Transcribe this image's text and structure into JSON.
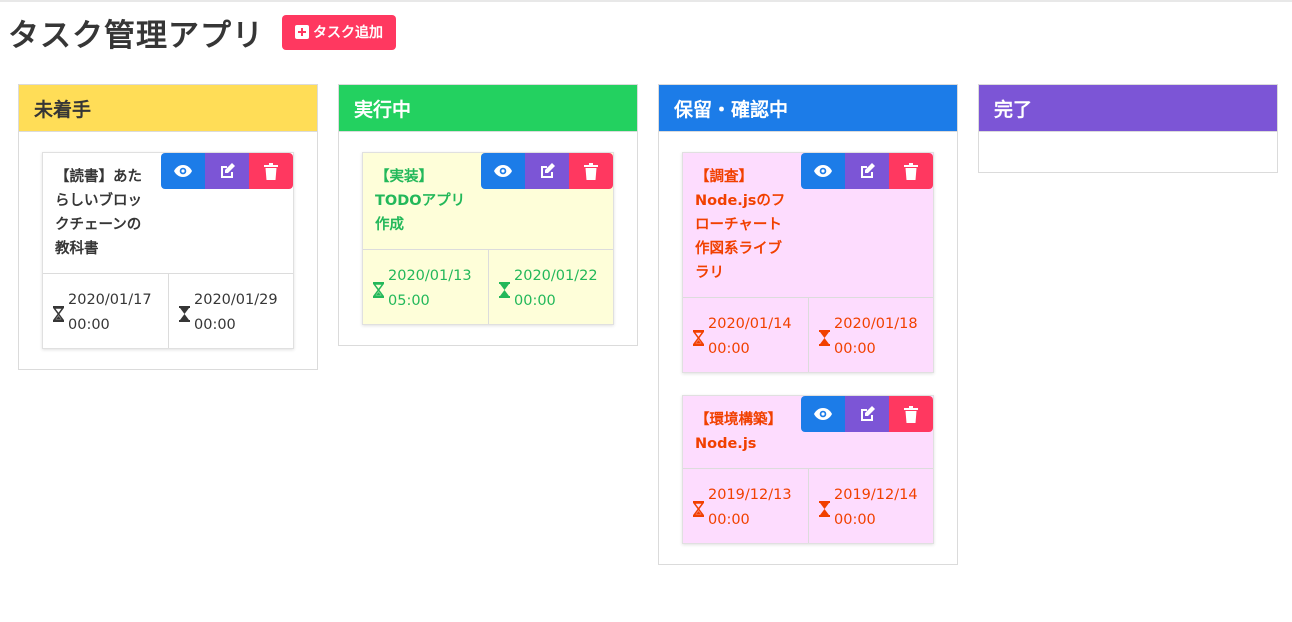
{
  "app": {
    "title": "タスク管理アプリ",
    "add_button": "タスク追加"
  },
  "colors": {
    "todo_header": "#ffdd57",
    "doing_header": "#23d160",
    "hold_header": "#1c7ce8",
    "done_header": "#7c55d6",
    "doing_card_bg": "#fefed9",
    "doing_card_text": "#23b85a",
    "hold_card_bg": "#fddcfe",
    "hold_card_text": "#f14000"
  },
  "columns": [
    {
      "title": "未着手",
      "cards": [
        {
          "title": "【読書】あたらしいブロックチェーンの教科書",
          "start": "2020/01/17 00:00",
          "due": "2020/01/29 00:00"
        }
      ]
    },
    {
      "title": "実行中",
      "cards": [
        {
          "title": "【実装】TODOアプリ作成",
          "start": "2020/01/13 05:00",
          "due": "2020/01/22 00:00"
        }
      ]
    },
    {
      "title": "保留・確認中",
      "cards": [
        {
          "title": "【調査】Node.jsのフローチャート作図系ライブラリ",
          "start": "2020/01/14 00:00",
          "due": "2020/01/18 00:00"
        },
        {
          "title": "【環境構築】Node.js",
          "start": "2019/12/13 00:00",
          "due": "2019/12/14 00:00"
        }
      ]
    },
    {
      "title": "完了",
      "cards": []
    }
  ],
  "icons": {
    "add": "plus-square-icon",
    "view": "eye-icon",
    "edit": "edit-icon",
    "delete": "trash-icon",
    "start_date": "hourglass-start-icon",
    "due_date": "hourglass-end-icon"
  }
}
